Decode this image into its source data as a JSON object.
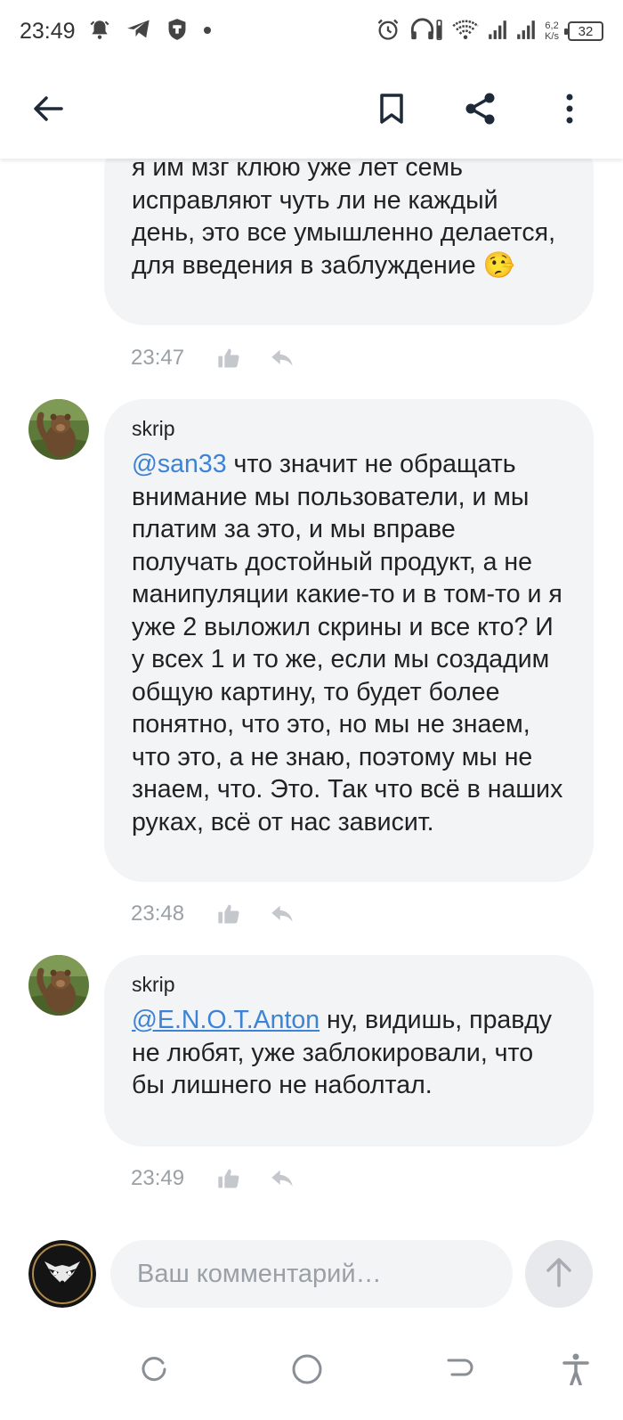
{
  "status_bar": {
    "time": "23:49",
    "net_speed_value": "6,2",
    "net_speed_unit": "K/s",
    "battery": "32"
  },
  "header": {
    "back_icon": "arrow-left-icon",
    "bookmark_icon": "bookmark-icon",
    "share_icon": "share-icon",
    "more_icon": "more-vertical-icon"
  },
  "comments": [
    {
      "author": "",
      "mention": "",
      "text": "я им мзг клюю уже лет семь исправляют чуть ли не каждый день, это все умышленно делается, для введения в заблуждение 🤥",
      "time": "23:47"
    },
    {
      "author": "skrip",
      "mention": "@san33",
      "text": " что значит не обращать внимание мы пользователи, и мы платим за это, и мы вправе получать достойный продукт, а не манипуляции какие-то и в том-то и я уже 2 выложил скрины и все кто? И у всех 1 и то же, если мы создадим общую картину, то будет более понятно, что это, но мы не знаем, что это, а не знаю, поэтому мы не знаем, что. Это. Так что всё в наших руках, всё от нас зависит.",
      "time": "23:48"
    },
    {
      "author": "skrip",
      "mention": "@E.N.O.T.Anton",
      "text": " ну, видишь, правду не любят, уже заблокировали, что бы лишнего не наболтал.",
      "time": "23:49"
    }
  ],
  "composer": {
    "placeholder": "Ваш комментарий…",
    "send_icon": "arrow-up-icon"
  },
  "colors": {
    "bubble_bg": "#f3f4f6",
    "mention": "#3d83d5",
    "meta_text": "#9aa0a6",
    "icon": "#1f2a38"
  }
}
